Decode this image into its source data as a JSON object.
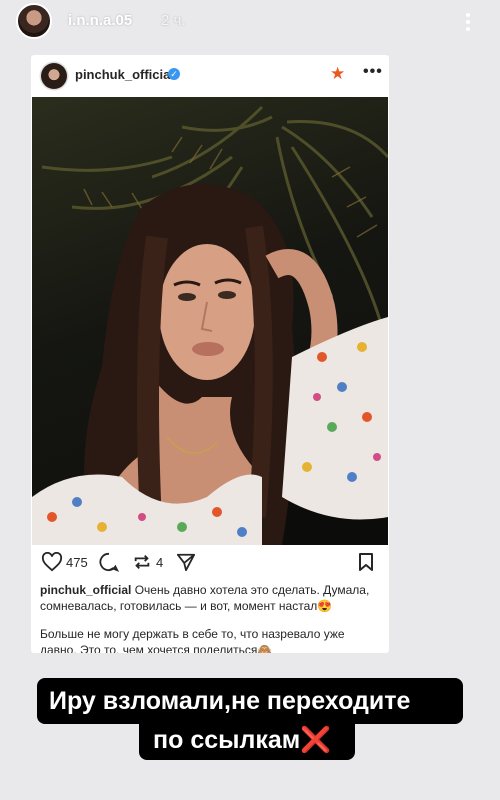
{
  "story": {
    "username": "i.n.n.a.05",
    "time": "2 ч."
  },
  "post": {
    "username": "pinchuk_official",
    "likes": "475",
    "reposts": "4",
    "caption_user": "pinchuk_official",
    "caption_text": " Очень давно хотела это сделать. Думала, сомневалась, готовилась — и вот, момент настал😍",
    "caption_p2": "Больше не могу держать в себе то, что назревало уже давно. Это то, чем хочется поделиться🙈"
  },
  "banner": {
    "line1": "Иру взломали,не переходите",
    "line2": "по ссылкам",
    "line2_mark": "❌"
  },
  "icons": {
    "story_menu": "more-vertical-icon",
    "verified": "verified-badge-icon",
    "star": "star-icon",
    "post_menu": "more-horizontal-icon",
    "like": "heart-icon",
    "comment": "comment-icon",
    "repost": "repost-icon",
    "share": "share-icon",
    "save": "bookmark-icon"
  },
  "colors": {
    "story_bg": "#e9e9eb",
    "verified": "#3897f0",
    "star": "#e85a1e",
    "banner_bg": "#000000",
    "x_mark": "#e22b2b"
  }
}
